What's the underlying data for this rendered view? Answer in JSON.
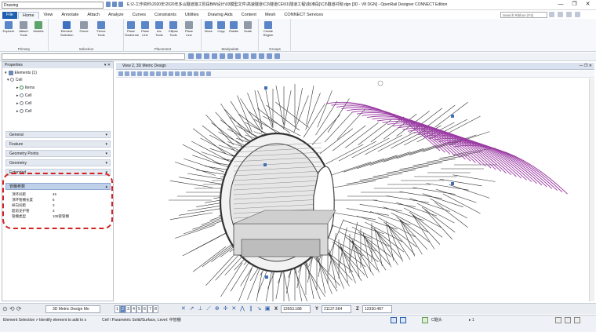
{
  "titlebar": {
    "workspace": "Drawing",
    "title": "E:\\2-工作资料\\2020年\\2020年多山隧道施工阶段BIM设计\\03模型文件\\高速隧道\\C3\\隧道CE\\01\\隧道工程\\[标准段]\\C3\\隧道衬砌.dgn [3D - V8 DGN] - OpenRail Designer CONNECT Edition",
    "controls": [
      "—",
      "❐",
      "✕"
    ]
  },
  "tabs": [
    "File",
    "Home",
    "View",
    "Annotate",
    "Attach",
    "Analyze",
    "Curves",
    "Constraints",
    "Utilities",
    "Drawing Aids",
    "Content",
    "Mesh",
    "CONNECT Services"
  ],
  "active_tab": "Home",
  "search": {
    "placeholder": "Search Ribbon (F4)"
  },
  "ribbon": {
    "groups": [
      {
        "label": "Primary",
        "buttons": [
          "Explorer",
          "Attach Tools",
          "Models"
        ]
      },
      {
        "label": "Selection",
        "buttons": [
          "Element Selection",
          "Fence",
          "Fence Tools"
        ]
      },
      {
        "label": "Placement",
        "buttons": [
          "Place SmartLine",
          "Place Line",
          "Arc Tools",
          "Ellipse Tools",
          "Place Line"
        ]
      },
      {
        "label": "Manipulate",
        "buttons": [
          "Move",
          "Copy",
          "Rotate",
          "Scale"
        ]
      },
      {
        "label": "Groups",
        "buttons": [
          "Create Region"
        ]
      }
    ]
  },
  "properties": {
    "title": "Properties",
    "toolbar_label": "Elements (1)",
    "tree": [
      "Cell",
      "Items",
      "Cell",
      "Cell",
      "Cell"
    ],
    "sections": [
      "General",
      "Feature",
      "Geometry Points",
      "Geometry",
      "Extended"
    ],
    "group_label": "管棚参数",
    "rows": [
      {
        "key": "顶环间距",
        "value": "45"
      },
      {
        "key": "顶环管棚长度",
        "value": "6"
      },
      {
        "key": "纵向间距",
        "value": "3"
      },
      {
        "key": "超前支护管",
        "value": "3"
      },
      {
        "key": "管棚类型",
        "value": "108管管棚"
      }
    ]
  },
  "view": {
    "title": "View 2, 3D Metric Design",
    "controls": [
      "—",
      "❐",
      "✕"
    ]
  },
  "navbar": {
    "view_dropdown": "3D Metric Design Mo",
    "view_numbers": [
      "1",
      "2",
      "3",
      "4",
      "5",
      "6",
      "7",
      "8"
    ],
    "active_view": "2",
    "x_label": "X",
    "x_value": "12653.188",
    "y_label": "Y",
    "y_value": "21137.564",
    "z_label": "Z",
    "z_value": "12330.487"
  },
  "statusbar": {
    "left": "Element Selection > Identify element to add to s",
    "mid": "Cell \\ Parametric Solid/Surface, Level: 中管棚",
    "level": "C隧头",
    "page": "1"
  },
  "colors": {
    "accent": "#1f5fb0",
    "highlight_dash": "#d42020",
    "pipes": "#9a3aa3"
  }
}
